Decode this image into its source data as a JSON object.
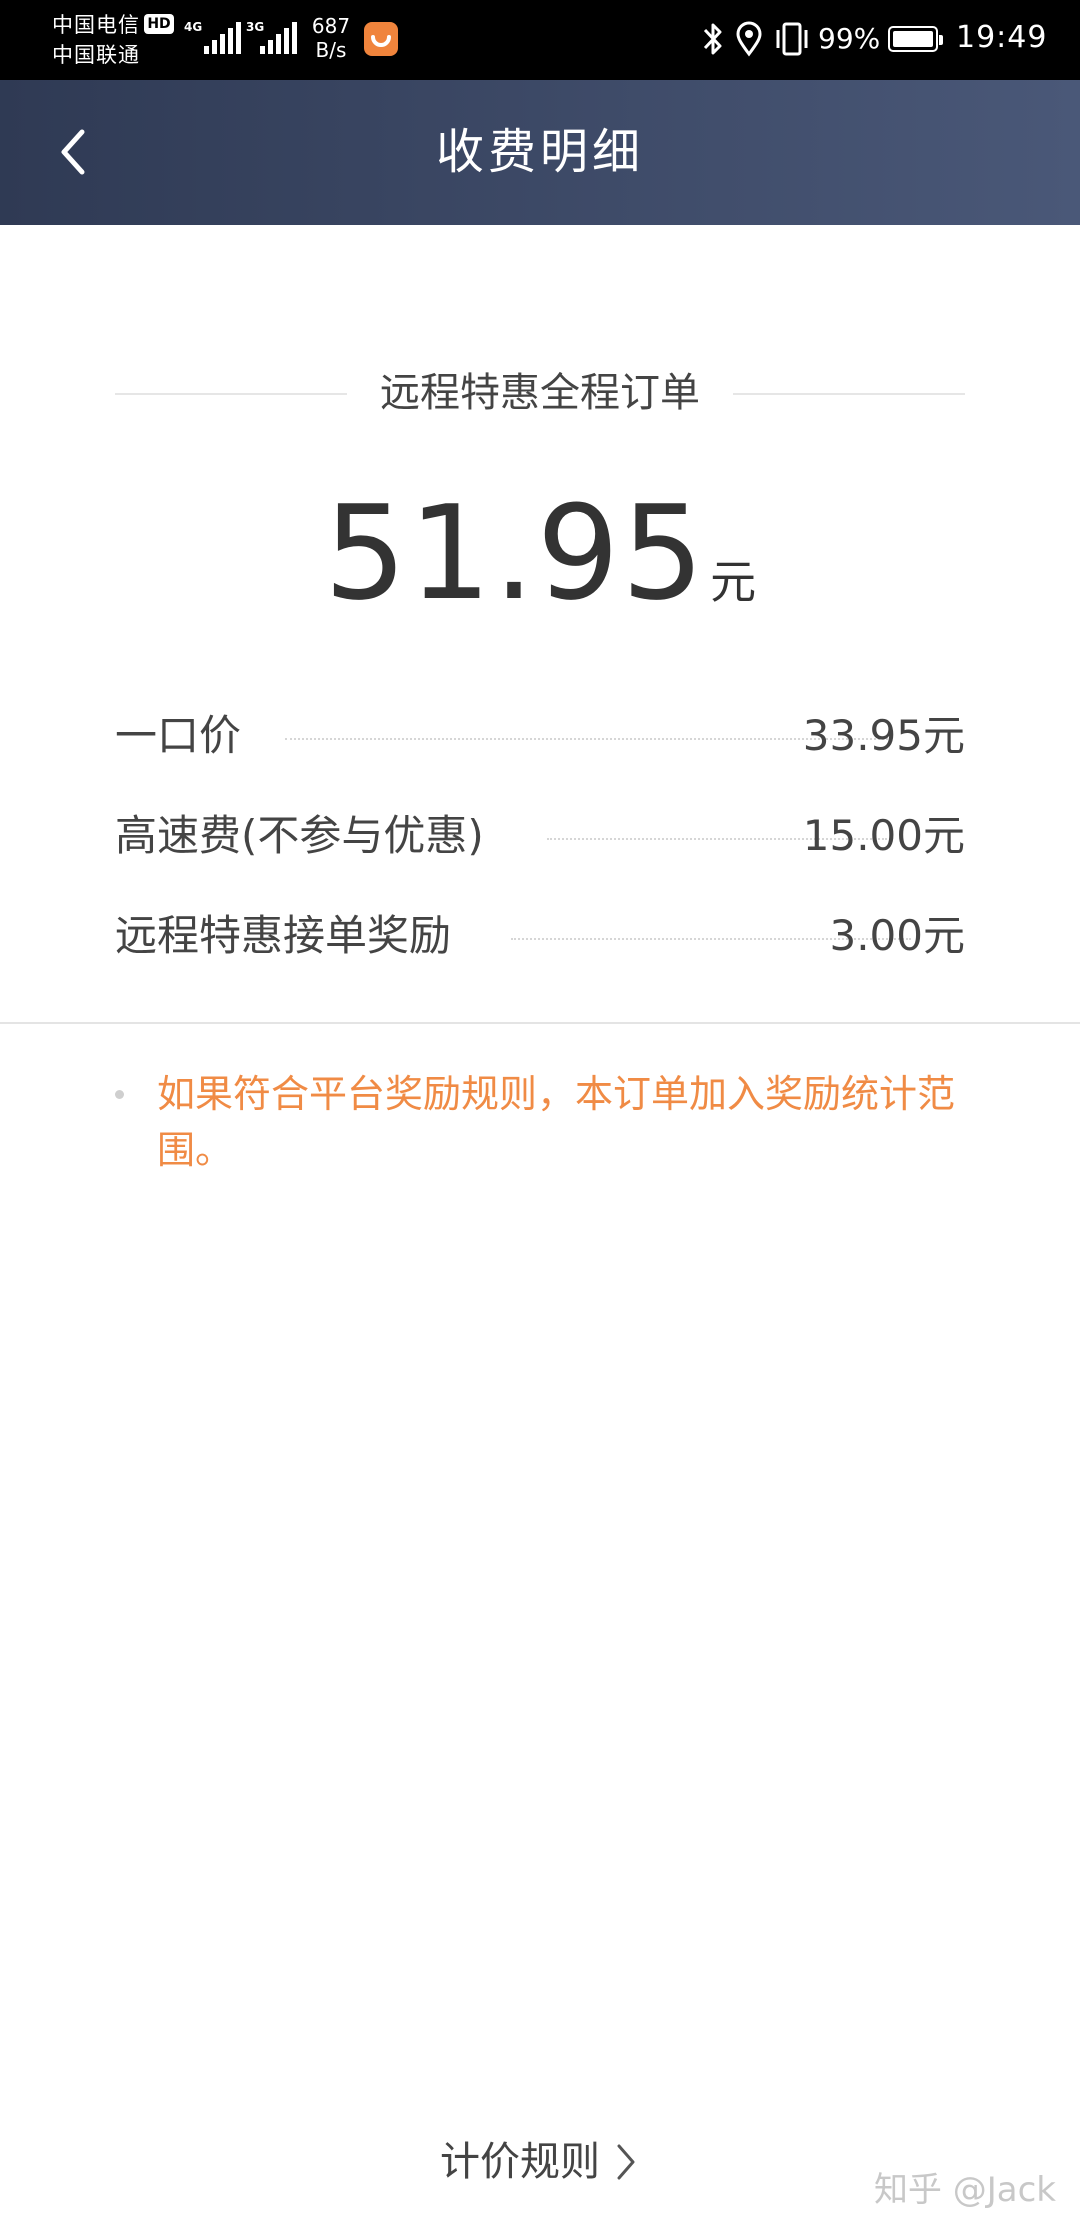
{
  "status_bar": {
    "carrier_1": "中国电信",
    "carrier_2": "中国联通",
    "hd_badge": "HD",
    "network_1": "4G",
    "network_2": "3G",
    "speed_value": "687",
    "speed_unit": "B/s",
    "battery_percent": "99%",
    "battery_level": 0.99,
    "time": "19:49",
    "icons": [
      "signal-icon",
      "didi-app-icon",
      "bluetooth-icon",
      "location-icon",
      "vibrate-icon",
      "battery-icon"
    ]
  },
  "nav": {
    "title": "收费明细",
    "back_icon": "chevron-left-icon"
  },
  "order": {
    "type_label": "远程特惠全程订单",
    "total_amount": "51.95",
    "total_unit": "元",
    "fees": [
      {
        "label": "一口价",
        "value": "33.95元"
      },
      {
        "label": "高速费(不参与优惠)",
        "value": "15.00元"
      },
      {
        "label": "远程特惠接单奖励",
        "value": "3.00元"
      }
    ]
  },
  "notice": {
    "text": "如果符合平台奖励规则，本订单加入奖励统计范围。"
  },
  "footer": {
    "pricing_rules_label": "计价规则",
    "watermark": "知乎 @Jack"
  },
  "colors": {
    "nav_gradient_start": "#2f3a54",
    "nav_gradient_end": "#4a5878",
    "notice_orange": "#f08b45",
    "text_primary": "#333333"
  }
}
